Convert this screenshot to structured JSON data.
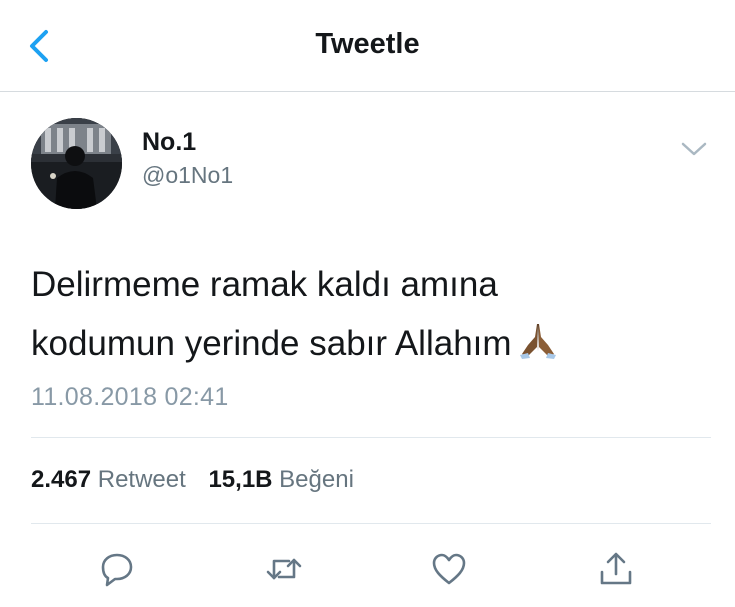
{
  "header": {
    "title": "Tweetle",
    "back_icon": "chevron-left-icon"
  },
  "colors": {
    "accent": "#1da1f2",
    "secondary_text": "#66757f",
    "timestamp": "#8899a6"
  },
  "tweet": {
    "name": "No.1",
    "handle": "@o1No1",
    "text_line1": "Delirmeme ramak kaldı amına",
    "text_line2": "kodumun yerinde sabır Allahım",
    "emoji": "folded-hands-emoji",
    "timestamp": "11.08.2018 02:41",
    "retweet_count": "2.467",
    "retweet_label": "Retweet",
    "like_count": "15,1B",
    "like_label": "Beğeni"
  },
  "actions": [
    "reply-icon",
    "retweet-icon",
    "like-icon",
    "share-icon"
  ]
}
